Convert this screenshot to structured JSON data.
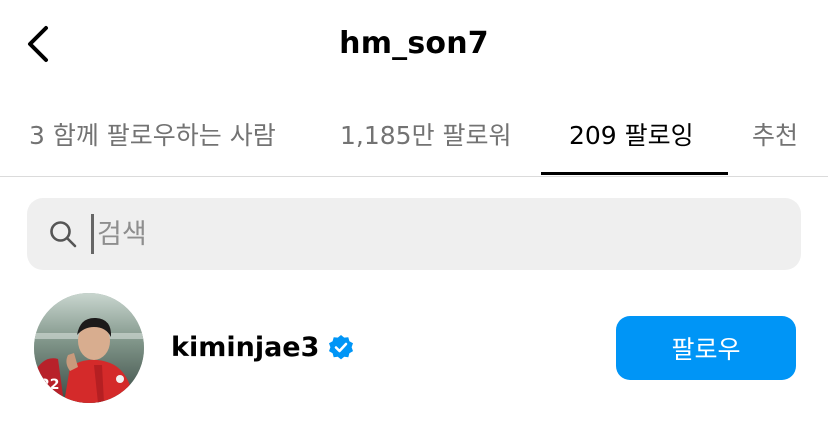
{
  "header": {
    "title": "hm_son7",
    "back_icon": "chevron-left-icon"
  },
  "tabs": [
    {
      "label": "3 함께 팔로우하는 사람",
      "active": false
    },
    {
      "label": "1,185만 팔로워",
      "active": false
    },
    {
      "label": "209 팔로잉",
      "active": true
    },
    {
      "label": "추천",
      "active": false
    }
  ],
  "search": {
    "placeholder": "검색",
    "value": "",
    "icon": "search-icon"
  },
  "users": [
    {
      "username": "kiminjae3",
      "verified": true,
      "follow_label": "팔로우"
    }
  ],
  "colors": {
    "accent": "#0095f6",
    "verified": "#0095f6",
    "search_bg": "#efefef",
    "muted_text": "#737373",
    "divider": "#dbdbdb"
  }
}
